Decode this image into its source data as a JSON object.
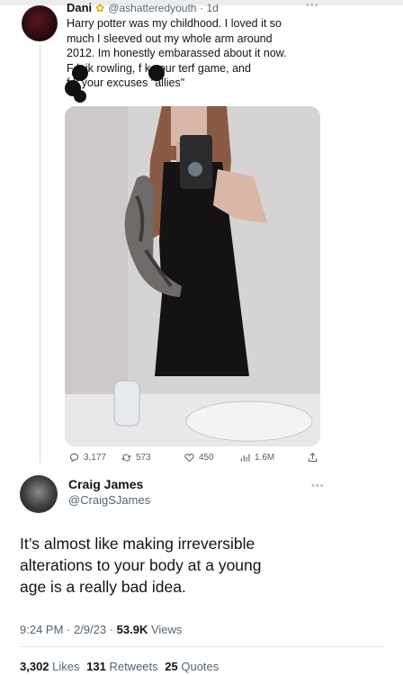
{
  "tweet": {
    "name": "Dani",
    "badge_icon": "sunflower-icon",
    "handle": "@ashatteredyouth",
    "time": "· 1d",
    "lines": [
      "Harry potter was my childhood. I loved it so",
      "much I sleeved out my whole arm around",
      "2012. Im honestly embarassed about it now.",
      "F   k jk rowling, f   k your terf game, and",
      "f   k your excuses \"allies\""
    ],
    "actions": {
      "replies": "3,177",
      "retweets": "573",
      "likes": "450",
      "views": "1.6M"
    }
  },
  "reply": {
    "name": "Craig James",
    "handle": "@CraigSJames",
    "lines": [
      "It’s almost like making irreversible",
      "alterations to your body at a young",
      "age is a really bad idea."
    ],
    "time": "9:24 PM · 2/9/23 · ",
    "views_count": "53.9K",
    "views_label": " Views",
    "likes_count": "3,302",
    "likes_label": " Likes",
    "retweets_count": "131",
    "retweets_label": " Retweets",
    "quotes_count": "25",
    "quotes_label": " Quotes"
  },
  "colors": {
    "text": "#0f1419",
    "secondary": "#536471",
    "divider": "#e5e8ea"
  }
}
